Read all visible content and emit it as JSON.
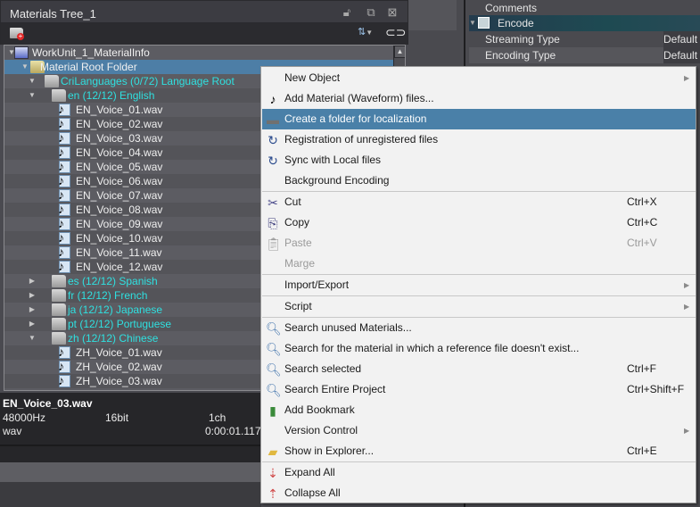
{
  "panel": {
    "title": "Materials Tree_1",
    "title_icons": [
      "lock-open-icon",
      "restore-icon",
      "close-icon"
    ]
  },
  "tree": [
    {
      "label": "WorkUnit_1_MaterialInfo",
      "depth": 0,
      "icon": "workunit",
      "twisty": "open",
      "cyan": false
    },
    {
      "label": "Material Root Folder",
      "depth": 1,
      "icon": "folder-yellow",
      "twisty": "open",
      "cyan": false,
      "selected": true
    },
    {
      "label": "CriLanguages (0/72) Language Root",
      "depth": 2,
      "icon": "folder",
      "twisty": "open",
      "cyan": true
    },
    {
      "label": "en (12/12) English",
      "depth": 3,
      "icon": "folder",
      "twisty": "open",
      "cyan": true
    },
    {
      "label": "EN_Voice_01.wav",
      "depth": 4,
      "icon": "wav"
    },
    {
      "label": "EN_Voice_02.wav",
      "depth": 4,
      "icon": "wav"
    },
    {
      "label": "EN_Voice_03.wav",
      "depth": 4,
      "icon": "wav"
    },
    {
      "label": "EN_Voice_04.wav",
      "depth": 4,
      "icon": "wav"
    },
    {
      "label": "EN_Voice_05.wav",
      "depth": 4,
      "icon": "wav"
    },
    {
      "label": "EN_Voice_06.wav",
      "depth": 4,
      "icon": "wav"
    },
    {
      "label": "EN_Voice_07.wav",
      "depth": 4,
      "icon": "wav"
    },
    {
      "label": "EN_Voice_08.wav",
      "depth": 4,
      "icon": "wav"
    },
    {
      "label": "EN_Voice_09.wav",
      "depth": 4,
      "icon": "wav"
    },
    {
      "label": "EN_Voice_10.wav",
      "depth": 4,
      "icon": "wav"
    },
    {
      "label": "EN_Voice_11.wav",
      "depth": 4,
      "icon": "wav"
    },
    {
      "label": "EN_Voice_12.wav",
      "depth": 4,
      "icon": "wav"
    },
    {
      "label": "es (12/12) Spanish",
      "depth": 3,
      "icon": "folder",
      "twisty": "closed",
      "cyan": true
    },
    {
      "label": "fr (12/12) French",
      "depth": 3,
      "icon": "folder",
      "twisty": "closed",
      "cyan": true
    },
    {
      "label": "ja (12/12) Japanese",
      "depth": 3,
      "icon": "folder",
      "twisty": "closed",
      "cyan": true
    },
    {
      "label": "pt (12/12) Portuguese",
      "depth": 3,
      "icon": "folder",
      "twisty": "closed",
      "cyan": true
    },
    {
      "label": "zh (12/12) Chinese",
      "depth": 3,
      "icon": "folder",
      "twisty": "open",
      "cyan": true
    },
    {
      "label": "ZH_Voice_01.wav",
      "depth": 4,
      "icon": "wav"
    },
    {
      "label": "ZH_Voice_02.wav",
      "depth": 4,
      "icon": "wav"
    },
    {
      "label": "ZH_Voice_03.wav",
      "depth": 4,
      "icon": "wav"
    }
  ],
  "info": {
    "filename": "EN_Voice_03.wav",
    "sample_rate": "48000Hz",
    "bit_depth": "16bit",
    "channels": "1ch",
    "format": "wav",
    "duration": "0:00:01.117"
  },
  "properties": {
    "comments_label": "Comments",
    "encode_label": "Encode",
    "rows": [
      {
        "key": "Streaming Type",
        "value": "Default"
      },
      {
        "key": "Encoding Type",
        "value": "Default"
      }
    ]
  },
  "menu": {
    "items": [
      {
        "label": "New Object",
        "icon": "",
        "shortcut": "",
        "submenu": true
      },
      {
        "label": "Add Material (Waveform) files...",
        "icon": "wav-file-icon",
        "shortcut": ""
      },
      {
        "label": "Create a folder for localization",
        "icon": "folder-icon",
        "shortcut": "",
        "highlighted": true
      },
      {
        "label": "Registration of unregistered files",
        "icon": "refresh-icon",
        "shortcut": ""
      },
      {
        "label": "Sync with Local files",
        "icon": "refresh-icon",
        "shortcut": ""
      },
      {
        "label": "Background Encoding",
        "icon": "",
        "shortcut": ""
      },
      {
        "separator": true
      },
      {
        "label": "Cut",
        "icon": "scissors-icon",
        "shortcut": "Ctrl+X"
      },
      {
        "label": "Copy",
        "icon": "copy-icon",
        "shortcut": "Ctrl+C"
      },
      {
        "label": "Paste",
        "icon": "paste-icon",
        "shortcut": "Ctrl+V",
        "disabled": true
      },
      {
        "label": "Marge",
        "icon": "",
        "shortcut": "",
        "disabled": true
      },
      {
        "separator": true
      },
      {
        "label": "Import/Export",
        "icon": "",
        "shortcut": "",
        "submenu": true
      },
      {
        "separator": true
      },
      {
        "label": "Script",
        "icon": "",
        "shortcut": "",
        "submenu": true
      },
      {
        "separator": true
      },
      {
        "label": "Search unused Materials...",
        "icon": "search-icon",
        "shortcut": ""
      },
      {
        "label": "Search for the material in which a reference file doesn't exist...",
        "icon": "search-icon",
        "shortcut": ""
      },
      {
        "label": "Search selected",
        "icon": "search-icon",
        "shortcut": "Ctrl+F"
      },
      {
        "label": "Search Entire Project",
        "icon": "search-icon",
        "shortcut": "Ctrl+Shift+F"
      },
      {
        "label": "Add Bookmark",
        "icon": "bookmark-icon",
        "shortcut": ""
      },
      {
        "label": "Version Control",
        "icon": "",
        "shortcut": "",
        "submenu": true
      },
      {
        "label": "Show in Explorer...",
        "icon": "open-folder-icon",
        "shortcut": "Ctrl+E"
      },
      {
        "separator": true
      },
      {
        "label": "Expand All",
        "icon": "expand-all-icon",
        "shortcut": ""
      },
      {
        "label": "Collapse All",
        "icon": "collapse-all-icon",
        "shortcut": ""
      }
    ]
  },
  "colors": {
    "selection": "#4d7ea6",
    "menu_highlight": "#4a80a8",
    "language_folder_text": "#2fe0e0"
  }
}
